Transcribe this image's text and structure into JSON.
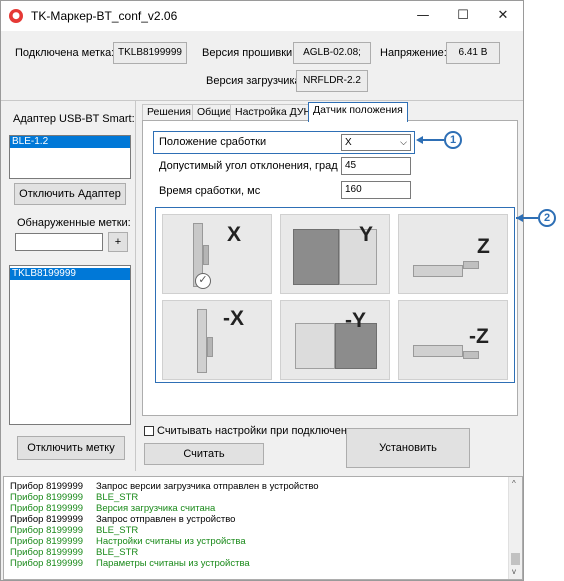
{
  "window": {
    "title": "TK-Маркер-BT_conf_v2.06",
    "minimize": "—",
    "maximize": "☐",
    "close": "✕"
  },
  "header": {
    "connected_label": "Подключена метка:",
    "connected_value": "TKLB8199999",
    "firmware_label": "Версия прошивки:",
    "firmware_value": "AGLB-02.08;",
    "voltage_label": "Напряжение:",
    "voltage_value": "6.41 В",
    "bootloader_label": "Версия загрузчика:",
    "bootloader_value": "NRFLDR-2.2"
  },
  "left": {
    "adapter_label": "Адаптер USB-BT Smart:",
    "adapters": [
      "BLE-1.2"
    ],
    "disconnect_adapter": "Отключить Адаптер",
    "found_label": "Обнаруженные метки:",
    "search_value": "",
    "add_button": "+",
    "tags": [
      "TKLB8199999"
    ],
    "disconnect_tag": "Отключить метку"
  },
  "tabs": [
    "Решения",
    "Общие",
    "Настройка ДУН",
    "Датчик положения"
  ],
  "sensor": {
    "trigger_position_label": "Положение сработки",
    "trigger_position_value": "X",
    "angle_label": "Допустимый угол отклонения, град",
    "angle_value": "45",
    "time_label": "Время сработки, мс",
    "time_value": "160",
    "positions": [
      {
        "axis": "X",
        "selected": true
      },
      {
        "axis": "Y",
        "selected": false
      },
      {
        "axis": "Z",
        "selected": false
      },
      {
        "axis": "-X",
        "selected": false
      },
      {
        "axis": "-Y",
        "selected": false
      },
      {
        "axis": "-Z",
        "selected": false
      }
    ],
    "callout1": "1",
    "callout2": "2"
  },
  "bottom": {
    "read_on_connect_label": "Считывать настройки при подключении",
    "read_button": "Считать",
    "install_button": "Установить"
  },
  "log": [
    {
      "device": "Прибор 8199999",
      "message": "Запрос версии загрузчика отправлен в устройство",
      "color": "#000000"
    },
    {
      "device": "Прибор 8199999",
      "message": "BLE_STR",
      "color": "#1a8a1a"
    },
    {
      "device": "Прибор 8199999",
      "message": "Версия загрузчика считана",
      "color": "#1a8a1a"
    },
    {
      "device": "Прибор 8199999",
      "message": "Запрос отправлен в устройство",
      "color": "#000000"
    },
    {
      "device": "Прибор 8199999",
      "message": "BLE_STR",
      "color": "#1a8a1a"
    },
    {
      "device": "Прибор 8199999",
      "message": "Настройки считаны из устройства",
      "color": "#1a8a1a"
    },
    {
      "device": "Прибор 8199999",
      "message": "BLE_STR",
      "color": "#1a8a1a"
    },
    {
      "device": "Прибор 8199999",
      "message": "Параметры считаны из устройства",
      "color": "#1a8a1a"
    }
  ],
  "colors": {
    "accent": "#2e6fb5",
    "selection": "#0078d7",
    "log_ok": "#1a8a1a"
  }
}
